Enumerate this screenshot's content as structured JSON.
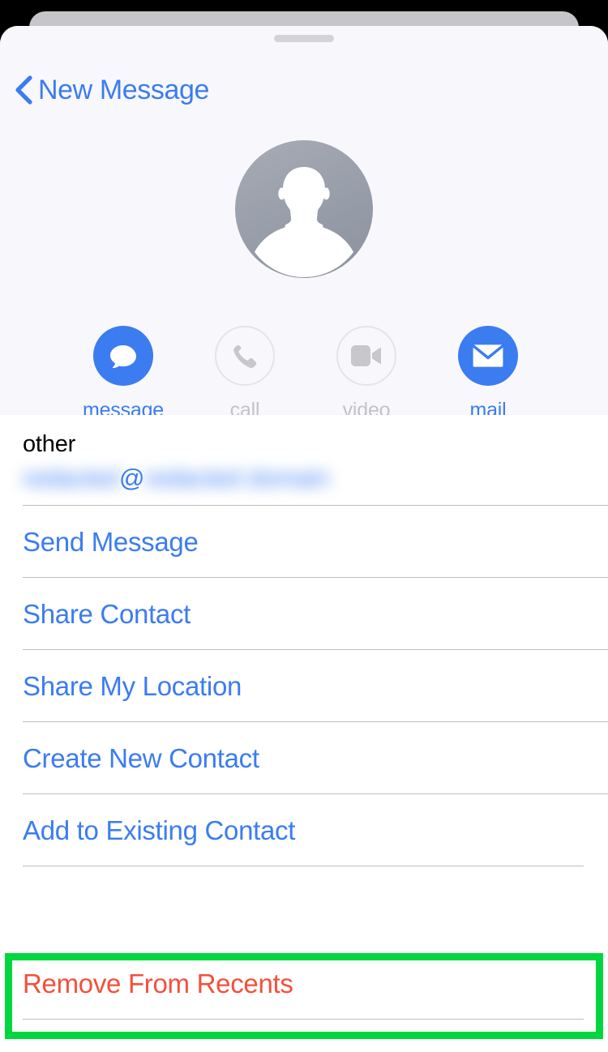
{
  "window": {
    "background_color": "#000000",
    "sheet_background": "#ffffff",
    "header_background": "#f8f8fc",
    "accent_color": "#3b7cf0",
    "destructive_color": "#f4503c",
    "highlight_color": "#00d63e"
  },
  "navigation": {
    "back_label": "New Message",
    "back_icon": "chevron-left-icon",
    "grabber": "drag-handle"
  },
  "contact": {
    "avatar_icon": "person-placeholder-icon",
    "avatar_type": "default-gray-silhouette"
  },
  "actions": [
    {
      "id": "message",
      "label": "message",
      "icon": "message-bubble-icon",
      "enabled": true
    },
    {
      "id": "call",
      "label": "call",
      "icon": "phone-icon",
      "enabled": false
    },
    {
      "id": "video",
      "label": "video",
      "icon": "video-camera-icon",
      "enabled": false
    },
    {
      "id": "mail",
      "label": "mail",
      "icon": "envelope-icon",
      "enabled": true
    }
  ],
  "field": {
    "label": "other",
    "value_username": "redacted",
    "value_at": "@",
    "value_domain": "redacted domain",
    "redacted": true
  },
  "list_items": [
    {
      "label": "Send Message",
      "style": "default"
    },
    {
      "label": "Share Contact",
      "style": "default"
    },
    {
      "label": "Share My Location",
      "style": "default"
    },
    {
      "label": "Create New Contact",
      "style": "default"
    },
    {
      "label": "Add to Existing Contact",
      "style": "default"
    }
  ],
  "destructive_item": {
    "label": "Remove From Recents",
    "style": "destructive",
    "highlighted": true
  }
}
